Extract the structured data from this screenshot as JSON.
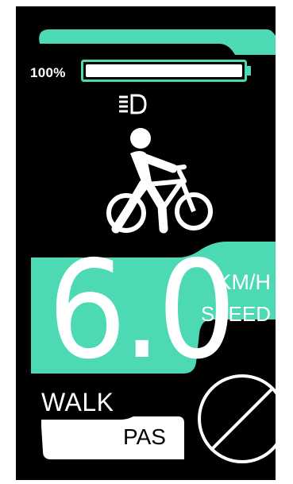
{
  "battery": {
    "percent_label": "100%",
    "level": 1.0
  },
  "speed": {
    "value": "6.0",
    "unit": "KM/H",
    "label": "SPEED"
  },
  "mode": {
    "walk_label": "WALK",
    "pas_label": "PAS"
  },
  "icons": {
    "top_arc": "status-arc",
    "headlight": "headlight-icon",
    "walker": "walk-bike-icon",
    "prohibited": "no-sign-icon"
  },
  "colors": {
    "accent": "#4dd9b4",
    "background": "#000000",
    "text": "#ffffff"
  }
}
